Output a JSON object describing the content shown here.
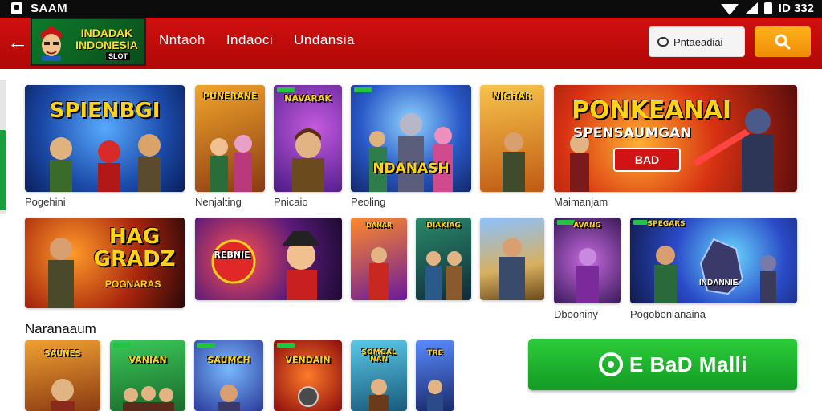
{
  "status_bar": {
    "app_name": "SAAM",
    "time": "ID 332"
  },
  "header": {
    "logo_text": "INDADAK INDONESIA",
    "logo_sub": "SLOT",
    "nav": [
      "Nntaoh",
      "Indaoci",
      "Undansia"
    ],
    "search_field_label": "Pntaeadiai"
  },
  "row1": [
    {
      "title": "SPIENBGI",
      "caption": "Pogehini"
    },
    {
      "title": "PUNERANE",
      "caption": "Nenjalting"
    },
    {
      "title": "NAVARAK",
      "caption": "Pnicaio"
    },
    {
      "title": "NDANASH",
      "caption": "Peoling"
    },
    {
      "title": "NIGHAR",
      "caption": ""
    },
    {
      "title": "PONKEANAI",
      "subtitle": "SPENSAUMGAN",
      "badge": "BAD",
      "caption": "Maimanjam"
    }
  ],
  "row2": [
    {
      "title": "HAG GRADZ",
      "subtitle": "POGNARAS",
      "caption": ""
    },
    {
      "title": "REBNIE",
      "caption": ""
    },
    {
      "title": "DANAR",
      "caption": ""
    },
    {
      "title": "DIAKIAG",
      "caption": ""
    },
    {
      "title": "",
      "caption": ""
    },
    {
      "title": "AVANG",
      "caption": "Dbooniny"
    },
    {
      "title": "SPEGARS",
      "subtitle": "INDANNIE",
      "caption": "Pogobonianaina"
    }
  ],
  "section_title": "Naranaaum",
  "row3": [
    {
      "title": "SAUNES"
    },
    {
      "title": "VANIAN"
    },
    {
      "title": "SAUMCH"
    },
    {
      "title": "VENDAIN"
    },
    {
      "title": "SOMGAL NAN"
    },
    {
      "title": "TRE"
    }
  ],
  "cta_label": "E BaD Malli",
  "colors": {
    "appbar": "#c40d0b",
    "accent_green": "#19a03c",
    "search_orange": "#f5a010"
  }
}
